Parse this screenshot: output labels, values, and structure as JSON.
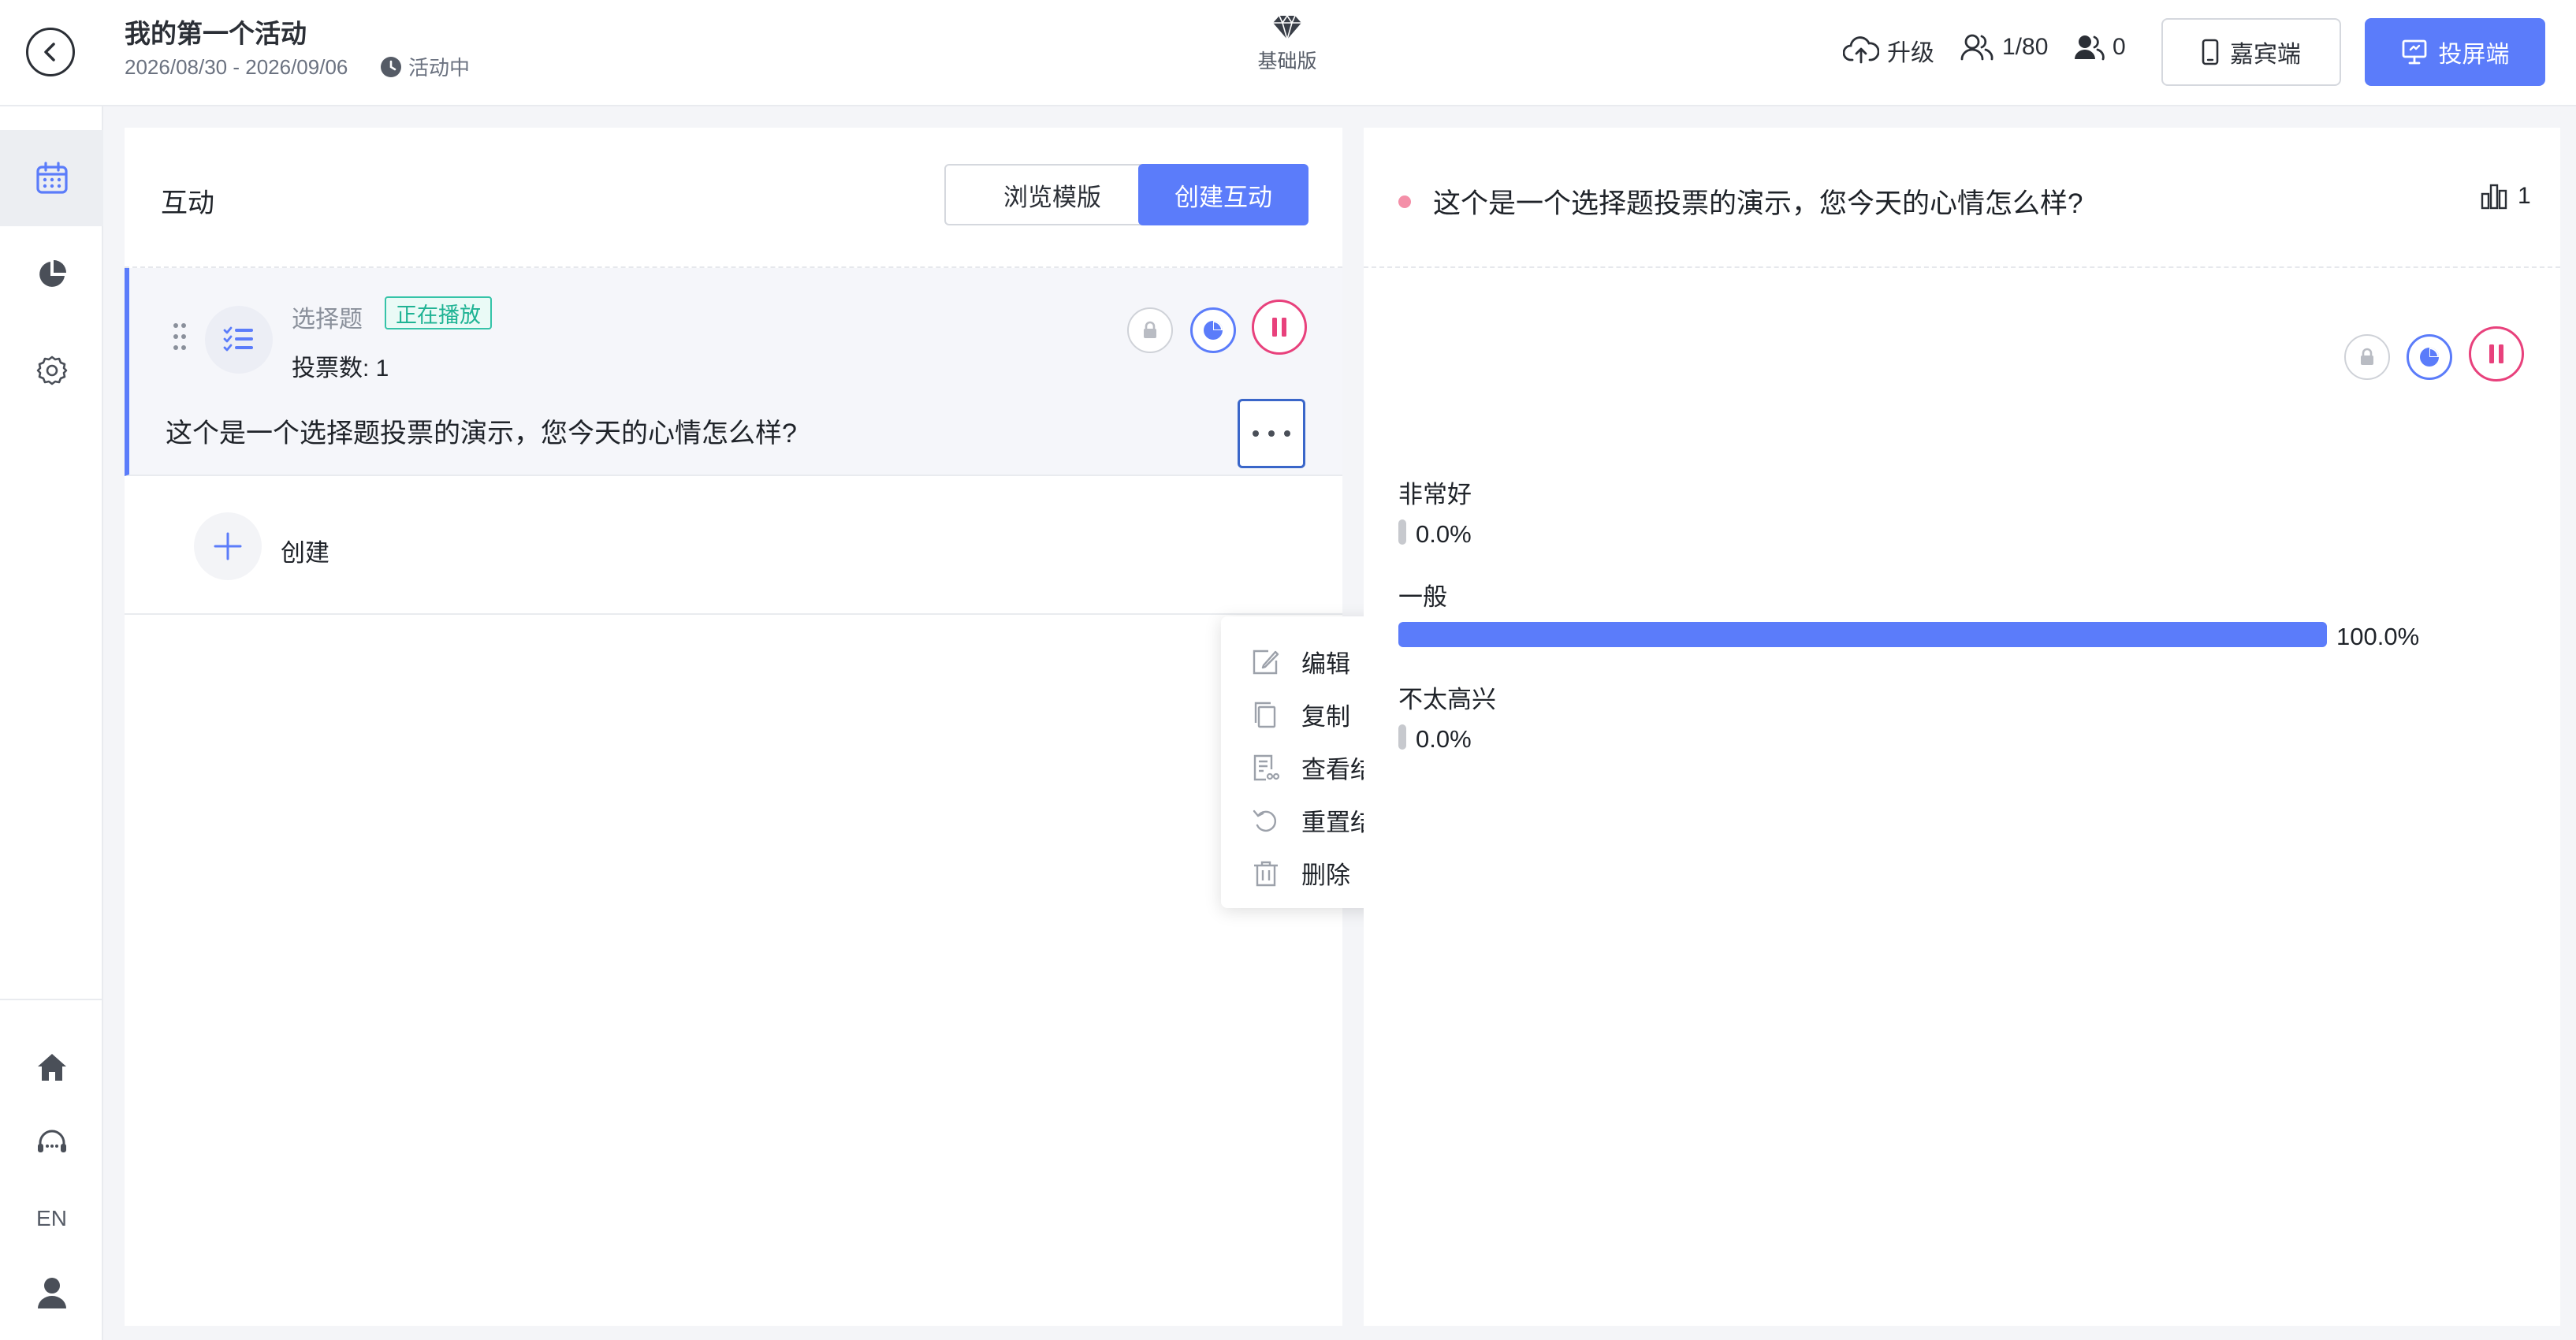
{
  "header": {
    "title": "我的第一个活动",
    "dates": "2026/08/30 - 2026/09/06",
    "status": "活动中",
    "plan": "基础版",
    "upgrade_label": "升级",
    "users_count": "1/80",
    "guests_count": "0",
    "guest_btn_label": "嘉宾端",
    "screen_btn_label": "投屏端"
  },
  "rail": {
    "lang": "EN"
  },
  "left_panel": {
    "title": "互动",
    "browse_label": "浏览模版",
    "create_label": "创建互动",
    "card": {
      "type_label": "选择题",
      "badge": "正在播放",
      "vote_count": "投票数: 1",
      "question": "这个是一个选择题投票的演示，您今天的心情怎么样?"
    },
    "create_row_label": "创建",
    "menu": [
      "编辑",
      "复制",
      "查看结果",
      "重置结果",
      "删除"
    ]
  },
  "right_panel": {
    "question": "这个是一个选择题投票的演示，您今天的心情怎么样?",
    "vote_total": "1",
    "options": [
      {
        "label": "非常好",
        "percent_text": "0.0%",
        "percent": 0
      },
      {
        "label": "一般",
        "percent_text": "100.0%",
        "percent": 100
      },
      {
        "label": "不太高兴",
        "percent_text": "0.0%",
        "percent": 0
      }
    ]
  },
  "colors": {
    "accent": "#5b7cfa",
    "pause": "#e8417c",
    "badge": "#1fb394"
  }
}
